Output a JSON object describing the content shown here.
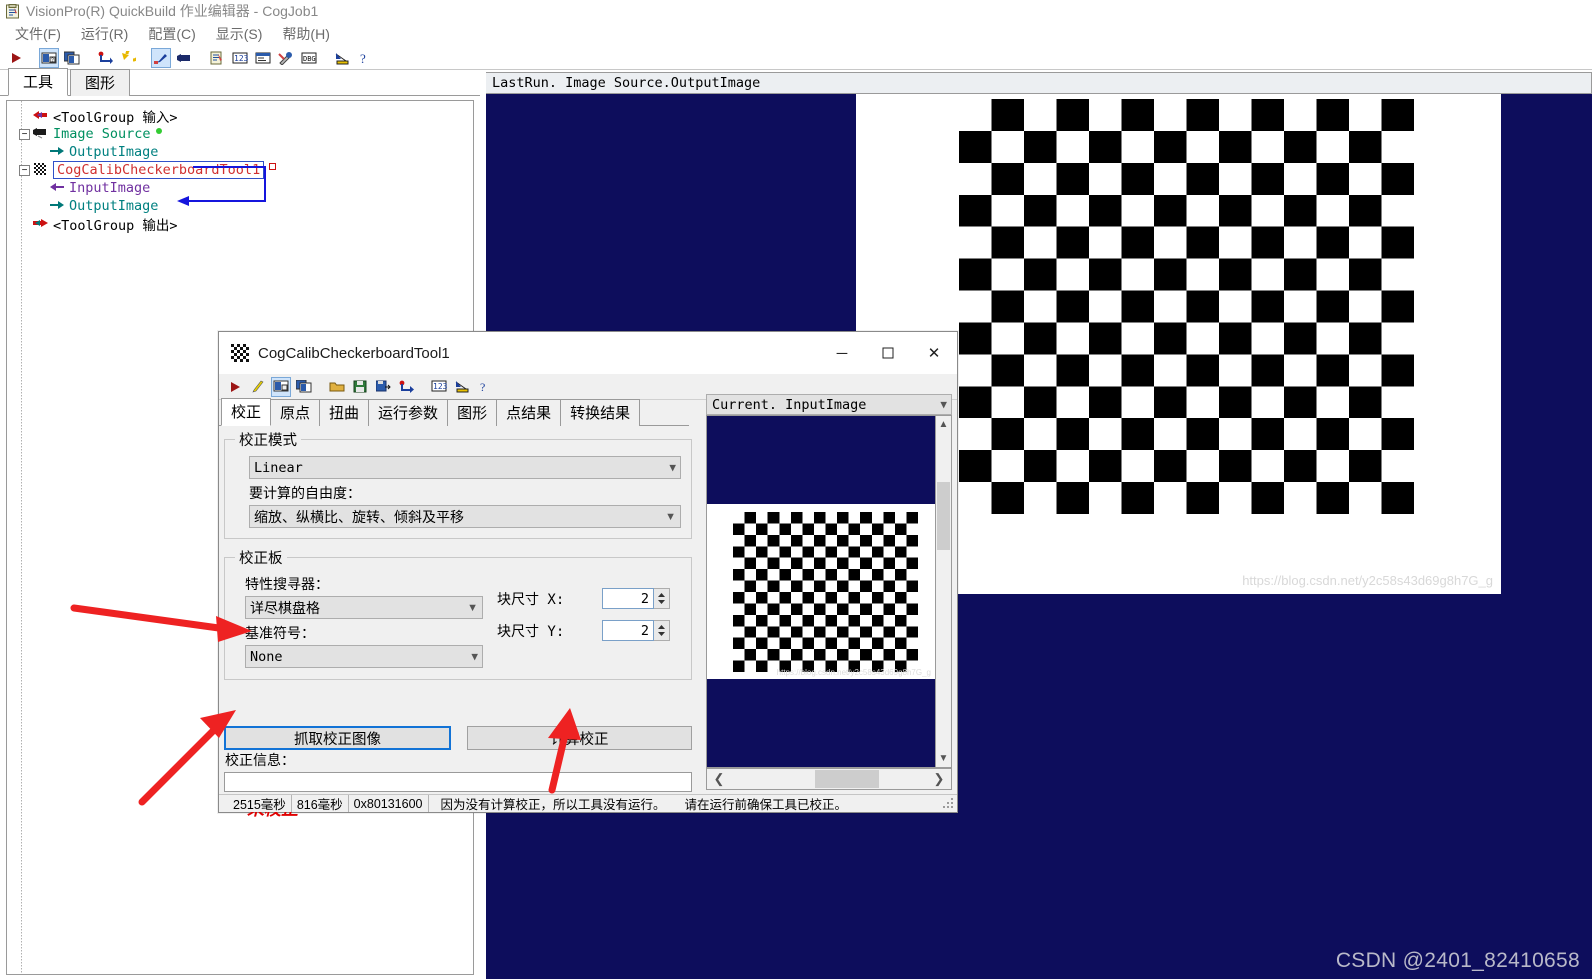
{
  "window": {
    "title": "VisionPro(R) QuickBuild 作业编辑器 - CogJob1",
    "menus": [
      "文件(F)",
      "运行(R)",
      "配置(C)",
      "显示(S)",
      "帮助(H)"
    ],
    "toolbar_icons": [
      "run-icon",
      "pencil-icon",
      "new-job-icon",
      "copy-job-icon",
      "load-icon",
      "undo-icon",
      "brush-icon",
      "camera-icon",
      "clipboard-icon",
      "numeric-icon",
      "properties-icon",
      "tools-icon",
      "debug-icon",
      "calibration-icon",
      "help-icon"
    ]
  },
  "left_panel": {
    "tabs": [
      {
        "label": "工具",
        "active": true
      },
      {
        "label": "图形",
        "active": false
      }
    ],
    "tree": [
      {
        "label": "<ToolGroup 输入>",
        "color": "black",
        "icon": "input-arrow-icon",
        "depth": 1,
        "expander": false
      },
      {
        "label": "Image Source",
        "color": "green",
        "icon": "camera-icon",
        "depth": 0,
        "expander": true,
        "dot": true
      },
      {
        "label": "OutputImage",
        "color": "teal",
        "icon": "out-arrow-icon",
        "depth": 2,
        "expander": false
      },
      {
        "label": "CogCalibCheckerboardTool1",
        "color": "red",
        "icon": "checkerboard-icon",
        "depth": 0,
        "expander": true,
        "selected": true
      },
      {
        "label": "InputImage",
        "color": "purple",
        "icon": "in-arrow-icon",
        "depth": 2,
        "expander": false
      },
      {
        "label": "OutputImage",
        "color": "teal",
        "icon": "out-arrow-icon",
        "depth": 2,
        "expander": false
      },
      {
        "label": "<ToolGroup 输出>",
        "color": "black",
        "icon": "output-arrow-icon",
        "depth": 1,
        "expander": false
      }
    ]
  },
  "viewer": {
    "label": "LastRun. Image Source.OutputImage",
    "watermark_url": "https://blog.csdn.net/y2c58s43d69g8h7G_g",
    "watermark_user": "CSDN @2401_82410658",
    "background_color": "#0d0d5c"
  },
  "dialog": {
    "title": "CogCalibCheckerboardTool1",
    "window_buttons": {
      "minimize": "─",
      "maximize": "☐",
      "close": "✕"
    },
    "toolbar_icons": [
      "run-icon",
      "pencil-icon",
      "new-icon",
      "copy-icon",
      "open-folder-icon",
      "save-icon",
      "save-as-icon",
      "undo-icon",
      "numeric-icon",
      "calibration-icon",
      "help-icon"
    ],
    "tabs": [
      {
        "label": "校正",
        "active": true
      },
      {
        "label": "原点",
        "active": false
      },
      {
        "label": "扭曲",
        "active": false
      },
      {
        "label": "运行参数",
        "active": false
      },
      {
        "label": "图形",
        "active": false
      },
      {
        "label": "点结果",
        "active": false
      },
      {
        "label": "转换结果",
        "active": false
      }
    ],
    "calib_mode_group": {
      "legend": "校正模式",
      "mode_value": "Linear",
      "dof_label": "要计算的自由度：",
      "dof_value": "缩放、纵横比、旋转、倾斜及平移"
    },
    "calib_plate_group": {
      "legend": "校正板",
      "feature_finder_label": "特性搜寻器：",
      "feature_finder_value": "详尽棋盘格",
      "fiducial_label": "基准符号：",
      "fiducial_value": "None",
      "tile_x_label": "块尺寸 X:",
      "tile_x_value": "2",
      "tile_y_label": "块尺寸 Y:",
      "tile_y_value": "2"
    },
    "buttons": {
      "grab": "抓取校正图像",
      "compute": "计算校正"
    },
    "info_label": "校正信息：",
    "info_value": "",
    "uncalibrated_text": "未校正",
    "statusbar": {
      "time1": "2515毫秒",
      "time2": "816毫秒",
      "code": "0x80131600",
      "message1": "因为没有计算校正，所以工具没有运行。",
      "message2": "请在运行前确保工具已校正。"
    },
    "preview": {
      "label": "Current. InputImage",
      "watermark": "https://blog.csdn.net/y2c58s43d69g8h7G_g"
    }
  },
  "colors": {
    "image_blue": "#0d0d5c",
    "accent_blue": "#1273d6",
    "error_red": "#e00000",
    "annotation_red": "#ee2222"
  }
}
